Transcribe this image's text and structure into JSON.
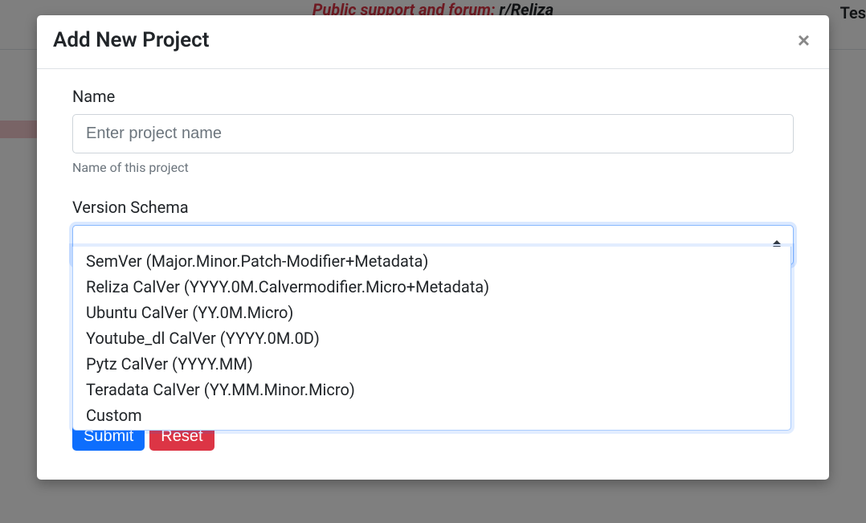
{
  "background": {
    "banner_prefix": "Public support and forum: ",
    "banner_link": "r/Reliza",
    "right_text": "Tes"
  },
  "modal": {
    "title": "Add New Project",
    "close_glyph": "×",
    "name": {
      "label": "Name",
      "placeholder": "Enter project name",
      "value": "",
      "help": "Name of this project"
    },
    "schema": {
      "label": "Version Schema",
      "selected": "",
      "options": [
        "SemVer (Major.Minor.Patch-Modifier+Metadata)",
        "Reliza CalVer (YYYY.0M.Calvermodifier.Micro+Metadata)",
        "Ubuntu CalVer (YY.0M.Micro)",
        "Youtube_dl CalVer (YYYY.0M.0D)",
        "Pytz CalVer (YYYY.MM)",
        "Teradata CalVer (YY.MM.Minor.Micro)",
        "Custom"
      ]
    },
    "buttons": {
      "submit": "Submit",
      "reset": "Reset"
    }
  }
}
